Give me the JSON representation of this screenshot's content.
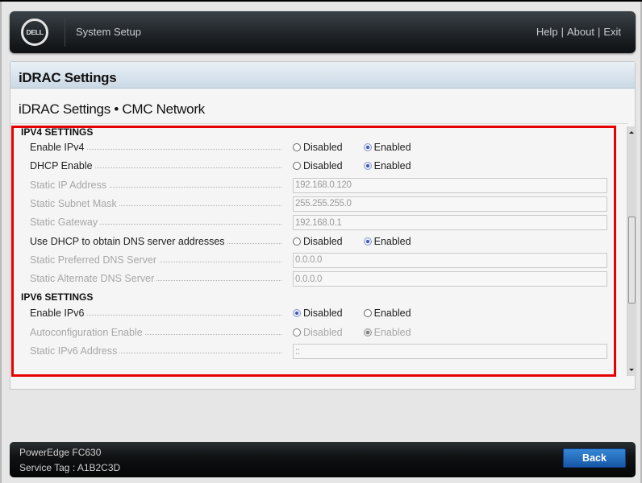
{
  "header": {
    "logo_text": "DELL",
    "title": "System Setup",
    "links": [
      "Help",
      "About",
      "Exit"
    ],
    "link_separator": "|"
  },
  "panel": {
    "title": "iDRAC Settings",
    "breadcrumb": "iDRAC Settings • CMC Network"
  },
  "ipv4": {
    "heading": "IPV4 SETTINGS",
    "rows": [
      {
        "label": "Enable IPv4",
        "type": "radio",
        "enabled": true,
        "options": [
          "Disabled",
          "Enabled"
        ],
        "selected": "Enabled"
      },
      {
        "label": "DHCP Enable",
        "type": "radio",
        "enabled": true,
        "options": [
          "Disabled",
          "Enabled"
        ],
        "selected": "Enabled"
      },
      {
        "label": "Static IP Address",
        "type": "text",
        "enabled": false,
        "value": "192.168.0.120"
      },
      {
        "label": "Static Subnet Mask",
        "type": "text",
        "enabled": false,
        "value": "255.255.255.0"
      },
      {
        "label": "Static Gateway",
        "type": "text",
        "enabled": false,
        "value": "192.168.0.1"
      },
      {
        "label": "Use DHCP to obtain DNS server addresses",
        "type": "radio",
        "enabled": true,
        "options": [
          "Disabled",
          "Enabled"
        ],
        "selected": "Enabled"
      },
      {
        "label": "Static Preferred DNS Server",
        "type": "text",
        "enabled": false,
        "value": "0.0.0.0"
      },
      {
        "label": "Static Alternate DNS Server",
        "type": "text",
        "enabled": false,
        "value": "0.0.0.0"
      }
    ]
  },
  "ipv6": {
    "heading": "IPV6 SETTINGS",
    "rows": [
      {
        "label": "Enable IPv6",
        "type": "radio",
        "enabled": true,
        "options": [
          "Disabled",
          "Enabled"
        ],
        "selected": "Disabled"
      },
      {
        "label": "Autoconfiguration Enable",
        "type": "radio",
        "enabled": false,
        "options": [
          "Disabled",
          "Enabled"
        ],
        "selected": "Enabled"
      },
      {
        "label": "Static IPv6 Address",
        "type": "text",
        "enabled": false,
        "value": "::"
      }
    ]
  },
  "scrollbar": {
    "position_fraction": 0.35,
    "visible_fraction": 0.36
  },
  "footer": {
    "model": "PowerEdge FC630",
    "service_tag_label": "Service Tag : A1B2C3D",
    "back_label": "Back"
  },
  "colors": {
    "highlight": "#e60000",
    "radio_selected": "#3d54b8",
    "back_button": "#1f6cc0"
  }
}
